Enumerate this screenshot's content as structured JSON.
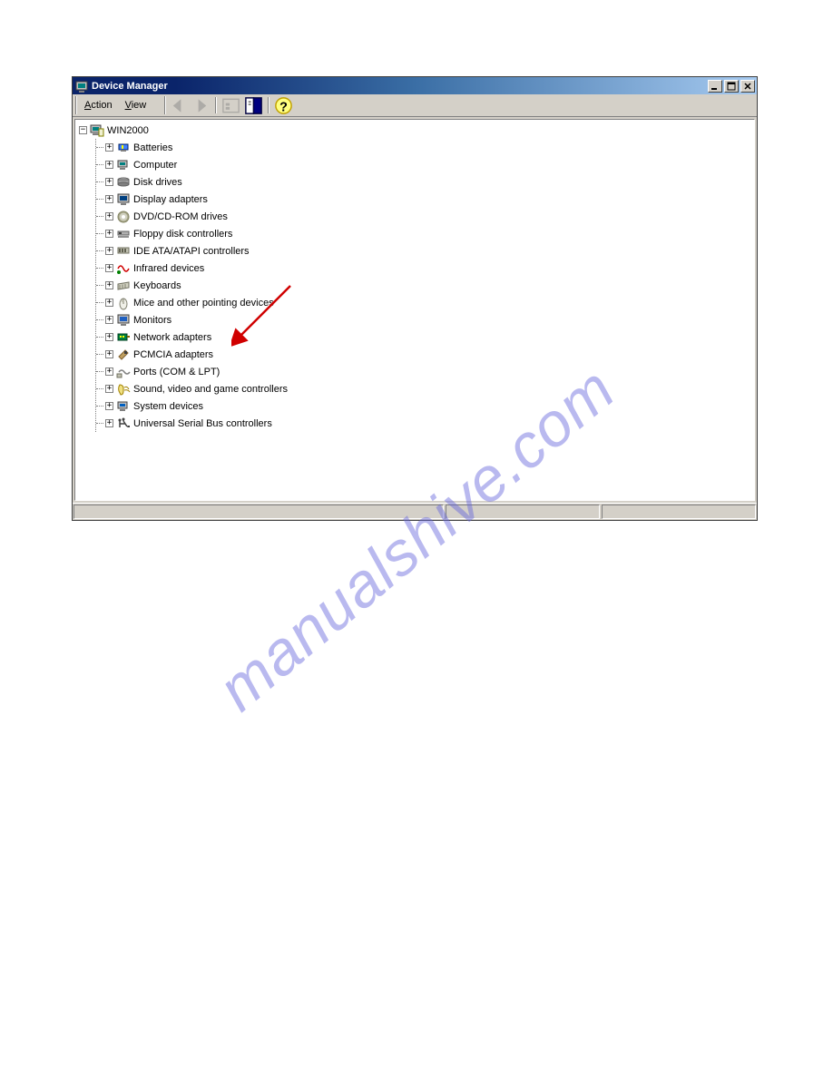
{
  "window": {
    "title": "Device Manager"
  },
  "menu": {
    "action": "Action",
    "view": "View"
  },
  "tree": {
    "root_expanded": "−",
    "child_collapsed": "+",
    "root": "WIN2000",
    "items": [
      "Batteries",
      "Computer",
      "Disk drives",
      "Display adapters",
      "DVD/CD-ROM drives",
      "Floppy disk controllers",
      "IDE ATA/ATAPI controllers",
      "Infrared devices",
      "Keyboards",
      "Mice and other pointing devices",
      "Monitors",
      "Network adapters",
      "PCMCIA adapters",
      "Ports (COM & LPT)",
      "Sound, video and game controllers",
      "System devices",
      "Universal Serial Bus controllers"
    ]
  },
  "watermark": "manualshive.com",
  "annotation": {
    "highlighted_item": "Network adapters"
  }
}
